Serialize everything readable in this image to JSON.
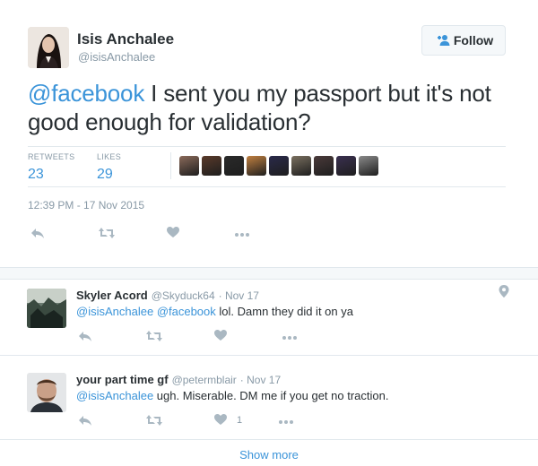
{
  "main_tweet": {
    "author_name": "Isis Anchalee",
    "author_handle": "@isisAnchalee",
    "follow_label": "Follow",
    "text_mention": "@facebook",
    "text_body": " I sent you my passport but it's not good enough for validation?",
    "retweets_label": "RETWEETS",
    "retweets_count": "23",
    "likes_label": "LIKES",
    "likes_count": "29",
    "timestamp": "12:39 PM - 17 Nov 2015",
    "liker_colors": [
      "#8a6a5a",
      "#5a3a2a",
      "#2a2a2a",
      "#c08040",
      "#2a2a4a",
      "#7a7060",
      "#4a3a3a",
      "#3a3050",
      "#8a8a8a"
    ]
  },
  "replies": [
    {
      "name": "Skyler Acord",
      "handle": "@Skyduck64",
      "date": "· Nov 17",
      "mention1": "@isisAnchalee",
      "mention2": "@facebook",
      "text": " lol. Damn they did it on ya",
      "like_count": ""
    },
    {
      "name": "your part time gf",
      "handle": "@petermblair",
      "date": "· Nov 17",
      "mention1": "@isisAnchalee",
      "mention2": "",
      "text": " ugh. Miserable. DM me if you get no traction.",
      "like_count": "1"
    }
  ],
  "show_more": "Show more",
  "icons": {
    "reply": "reply-icon",
    "retweet": "retweet-icon",
    "like": "heart-icon",
    "more": "more-icon",
    "follow": "add-user-icon",
    "geo": "location-pin-icon"
  },
  "colors": {
    "link": "#3b94d9",
    "muted": "#8899a6",
    "icon": "#aab8c2",
    "text": "#292f33"
  }
}
